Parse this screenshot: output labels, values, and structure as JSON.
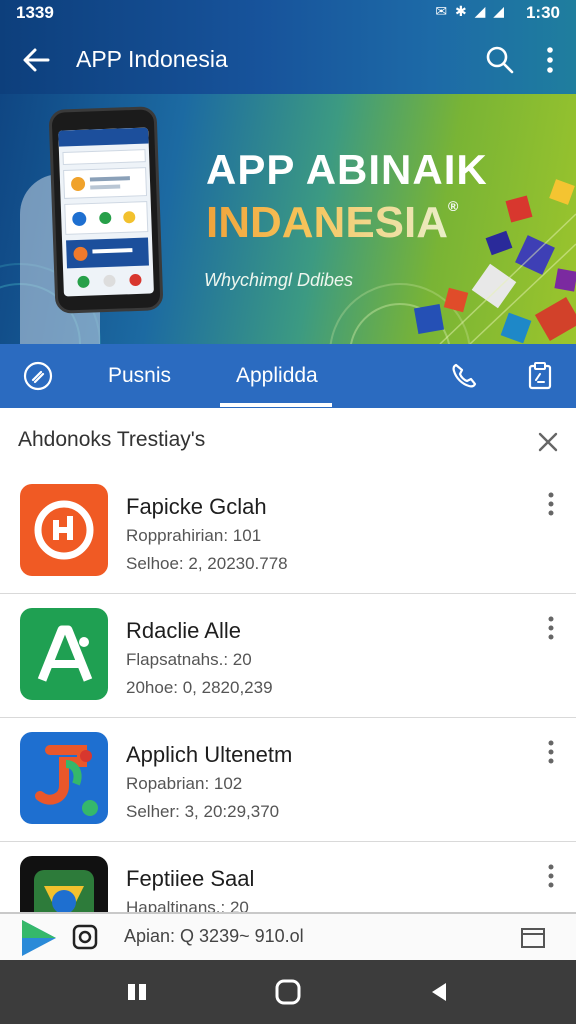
{
  "status_bar": {
    "time_left": "1339",
    "icons": "✉ ✱ ◢ ◢",
    "time_right": "1:30"
  },
  "app_bar": {
    "title": "APP Indonesia",
    "back_icon": "arrow-left-icon",
    "search_icon": "search-icon",
    "more_icon": "more-vertical-icon"
  },
  "banner": {
    "headline": "APP ABINAIK",
    "headline2": "INDANESIA",
    "trademark": "®",
    "subtitle": "Whychimgl Ddibes"
  },
  "tabs": {
    "items": [
      {
        "label": "Pusnis",
        "active": false
      },
      {
        "label": "Applidda",
        "active": true
      }
    ],
    "left_icon": "tag-icon",
    "phone_icon": "phone-icon",
    "clipboard_icon": "clipboard-icon"
  },
  "section": {
    "title": "Ahdonoks Trestiay's",
    "close_icon": "close-icon"
  },
  "apps": [
    {
      "name": "Fapicke Gclah",
      "meta1": "Ropprahirian: 101",
      "meta2": "Selhoe: 2, 20230.778",
      "icon_color": "#f05a24"
    },
    {
      "name": "Rdaclie Alle",
      "meta1": "Flapsatnahs.: 20",
      "meta2": "20hoe: 0, 2820,239",
      "icon_color": "#1fa052"
    },
    {
      "name": "Applich Ultenetm",
      "meta1": "Ropabrian: 102",
      "meta2": "Selher: 3, 20:29,370",
      "icon_color": "#1e6fd0"
    },
    {
      "name": "Feptiiee Saal",
      "meta1": "Hapaltinans.: 20",
      "meta2": "",
      "icon_color": "#111111"
    }
  ],
  "bottom_strip": {
    "text": "Apian: Q 3239~ 910.ol"
  },
  "nav": {
    "recents_icon": "recents-icon",
    "home_icon": "home-icon",
    "back_icon": "back-triangle-icon"
  }
}
